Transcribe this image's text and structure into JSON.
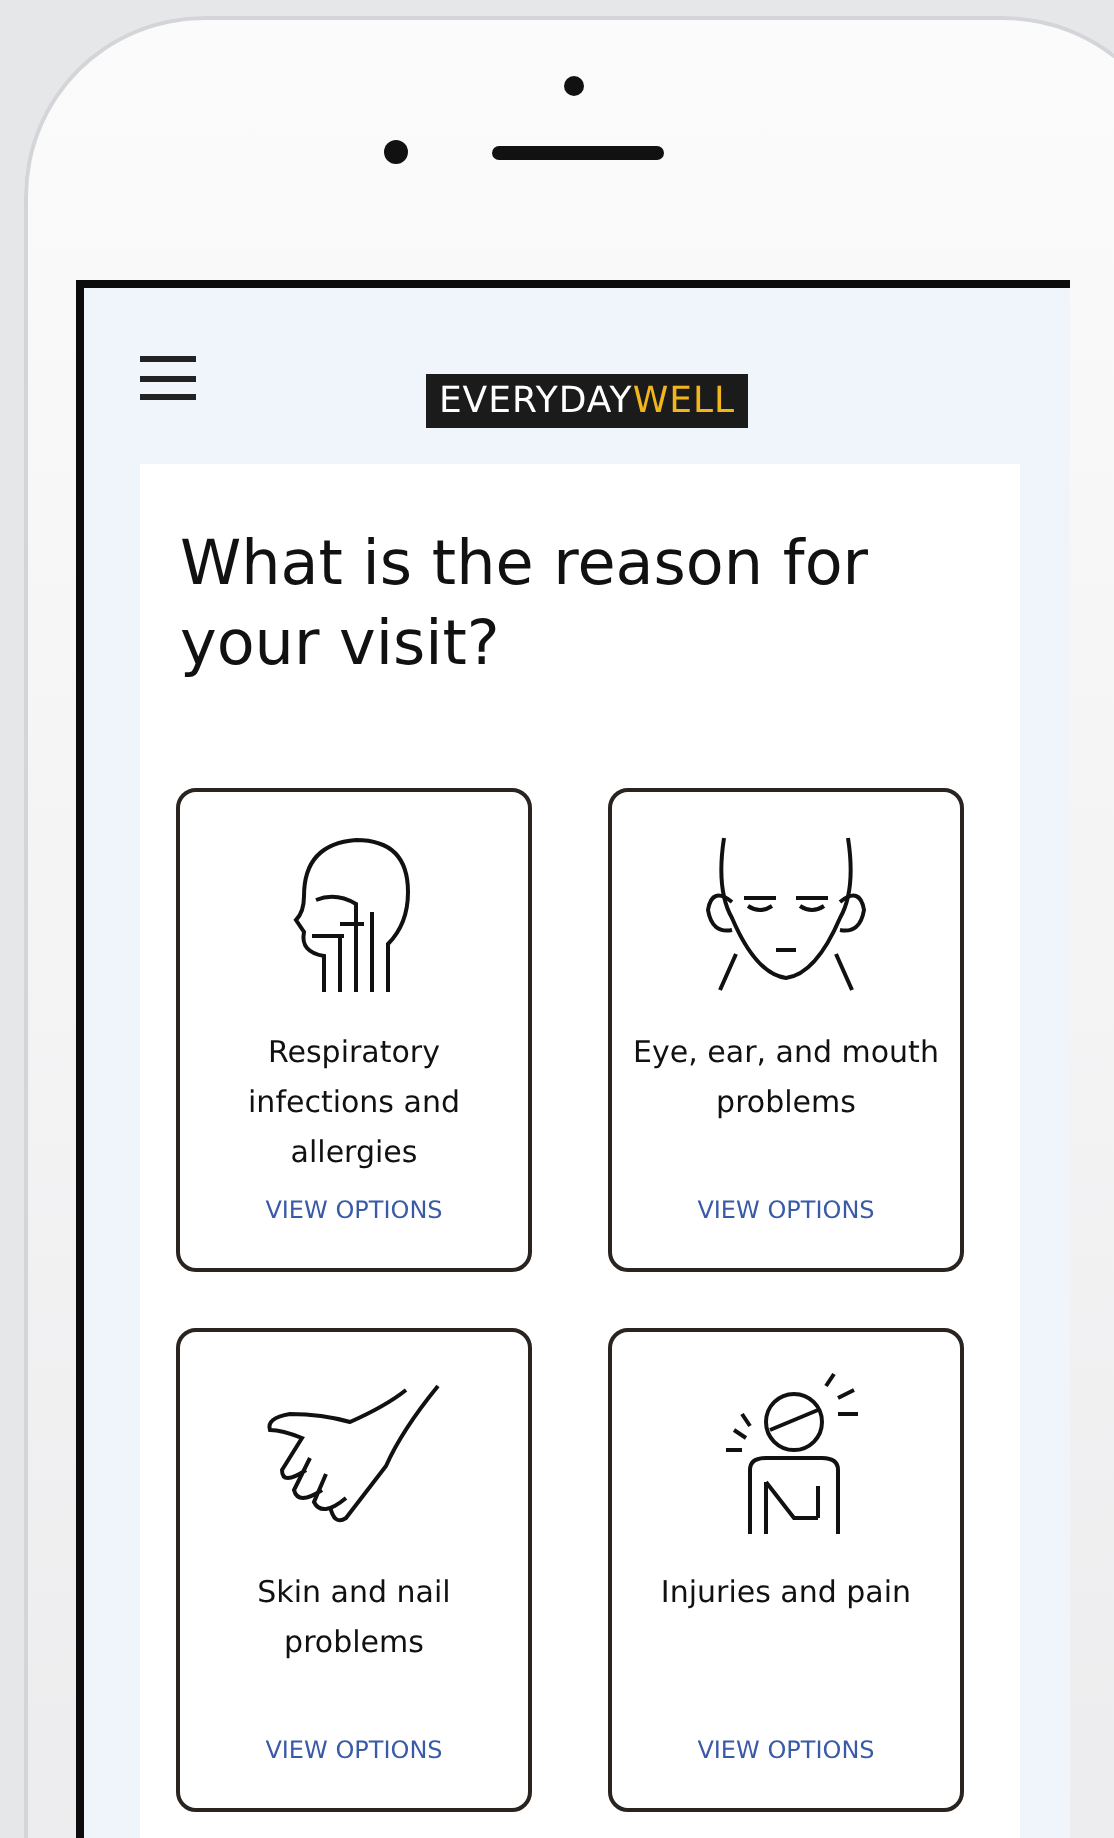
{
  "logo": {
    "first": "EVERYDAY",
    "second": "WELL"
  },
  "heading": "What is the reason for your visit?",
  "cards": [
    {
      "kind": "respiratory",
      "title": "Respiratory infections and allergies",
      "link": "VIEW OPTIONS"
    },
    {
      "kind": "face",
      "title": "Eye, ear, and mouth problems",
      "link": "VIEW OPTIONS"
    },
    {
      "kind": "hand",
      "title": "Skin and nail problems",
      "link": "VIEW OPTIONS"
    },
    {
      "kind": "injury",
      "title": "Injuries and pain",
      "link": "VIEW OPTIONS"
    }
  ]
}
